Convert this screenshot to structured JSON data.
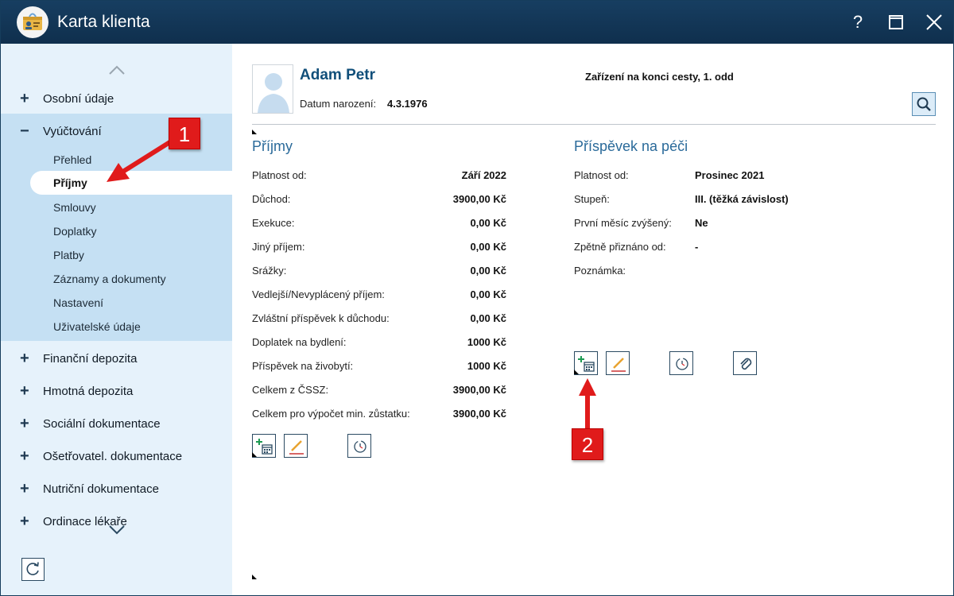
{
  "window": {
    "title": "Karta klienta",
    "help_label": "?"
  },
  "sidebar": {
    "groups": [
      {
        "label": "Osobní údaje"
      },
      {
        "label": "Vyúčtování"
      },
      {
        "label": "Finanční depozita"
      },
      {
        "label": "Hmotná depozita"
      },
      {
        "label": "Sociální dokumentace"
      },
      {
        "label": "Ošetřovatel. dokumentace"
      },
      {
        "label": "Nutriční dokumentace"
      },
      {
        "label": "Ordinace lékaře"
      }
    ],
    "sub_items": [
      {
        "label": "Přehled"
      },
      {
        "label": "Příjmy"
      },
      {
        "label": "Smlouvy"
      },
      {
        "label": "Doplatky"
      },
      {
        "label": "Platby"
      },
      {
        "label": "Záznamy a dokumenty"
      },
      {
        "label": "Nastavení"
      },
      {
        "label": "Uživatelské údaje"
      }
    ],
    "active_item": "Příjmy"
  },
  "client": {
    "name": "Adam Petr",
    "dob_label": "Datum narození:",
    "dob_value": "4.3.1976",
    "facility": "Zařízení na konci cesty, 1. odd"
  },
  "income": {
    "title": "Příjmy",
    "rows": [
      {
        "label": "Platnost od:",
        "value": "Září 2022"
      },
      {
        "label": "Důchod:",
        "value": "3900,00 Kč"
      },
      {
        "label": "Exekuce:",
        "value": "0,00 Kč"
      },
      {
        "label": "Jiný příjem:",
        "value": "0,00 Kč"
      },
      {
        "label": "Srážky:",
        "value": "0,00 Kč"
      },
      {
        "label": "Vedlejší/Nevyplácený příjem:",
        "value": "0,00 Kč"
      },
      {
        "label": "Zvláštní příspěvek k důchodu:",
        "value": "0,00 Kč"
      },
      {
        "label": "Doplatek na bydlení:",
        "value": "1000 Kč"
      },
      {
        "label": "Příspěvek na živobytí:",
        "value": "1000 Kč"
      },
      {
        "label": "Celkem z ČSSZ:",
        "value": "3900,00 Kč"
      },
      {
        "label": "Celkem pro výpočet min. zůstatku:",
        "value": "3900,00 Kč"
      }
    ]
  },
  "care": {
    "title": "Příspěvek na péči",
    "rows": [
      {
        "label": "Platnost od:",
        "value": "Prosinec 2021"
      },
      {
        "label": "Stupeň:",
        "value": "III. (těžká závislost)"
      },
      {
        "label": "První měsíc zvýšený:",
        "value": "Ne"
      },
      {
        "label": "Zpětně přiznáno od:",
        "value": "-"
      },
      {
        "label": "Poznámka:",
        "value": ""
      }
    ]
  },
  "callouts": [
    "1",
    "2"
  ],
  "colors": {
    "titlebar": "#173e61",
    "sidebar_bg": "#e6f2fb",
    "sidebar_expanded": "#c5e0f3",
    "accent": "#114f7a",
    "callout": "#e01b1b"
  }
}
